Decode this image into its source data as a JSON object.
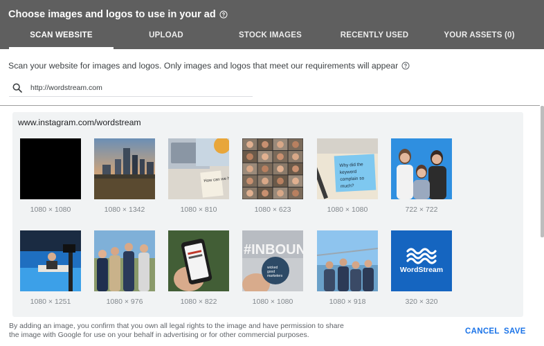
{
  "dialog": {
    "title": "Choose images and logos to use in your ad"
  },
  "tabs": [
    {
      "label": "SCAN WEBSITE",
      "active": true
    },
    {
      "label": "UPLOAD",
      "active": false
    },
    {
      "label": "STOCK IMAGES",
      "active": false
    },
    {
      "label": "RECENTLY USED",
      "active": false
    },
    {
      "label": "YOUR ASSETS (0)",
      "active": false
    }
  ],
  "scan": {
    "description": "Scan your website for images and logos. Only images and logos that meet our requirements will appear",
    "url_value": "http://wordstream.com"
  },
  "results": {
    "source": "www.instagram.com/wordstream",
    "images": [
      {
        "dimensions": "1080 × 1080",
        "description": "black square"
      },
      {
        "dimensions": "1080 × 1342",
        "description": "city skyline at sunset"
      },
      {
        "dimensions": "1080 × 810",
        "description": "laptop and sticky note 'How can we help?'"
      },
      {
        "dimensions": "1080 × 623",
        "description": "video call grid of people"
      },
      {
        "dimensions": "1080 × 1080",
        "description": "sticky note 'Why did the keyword complain so much?'"
      },
      {
        "dimensions": "722 × 722",
        "description": "three women on blue background"
      },
      {
        "dimensions": "1080 × 1251",
        "description": "man at desk in blue studio"
      },
      {
        "dimensions": "1080 × 976",
        "description": "group of four people outdoors"
      },
      {
        "dimensions": "1080 × 822",
        "description": "hand holding smartphone"
      },
      {
        "dimensions": "1080 × 1080",
        "description": "hand holding sticker in front of INBOUND sign"
      },
      {
        "dimensions": "1080 × 918",
        "description": "group in front of bridge"
      },
      {
        "dimensions": "320 × 320",
        "description": "WordStream logo"
      }
    ],
    "logo_text": "WordStream",
    "sticky_note_text": "Why did the keyword complain so much?",
    "note_text": "How can we help?",
    "sticker_text": "wicked good marketers",
    "sign_text": "#INBOUND"
  },
  "footer": {
    "legal_line1": "By adding an image, you confirm that you own all legal rights to the image and have permission to share",
    "legal_line2": "the image with Google for use on your behalf in advertising or for other commercial purposes.",
    "cancel_label": "CANCEL",
    "save_label": "SAVE"
  },
  "colors": {
    "header_bg": "#5f5f5f",
    "accent": "#1a73e8",
    "panel_bg": "#f1f3f4",
    "logo_bg": "#1565c0"
  }
}
